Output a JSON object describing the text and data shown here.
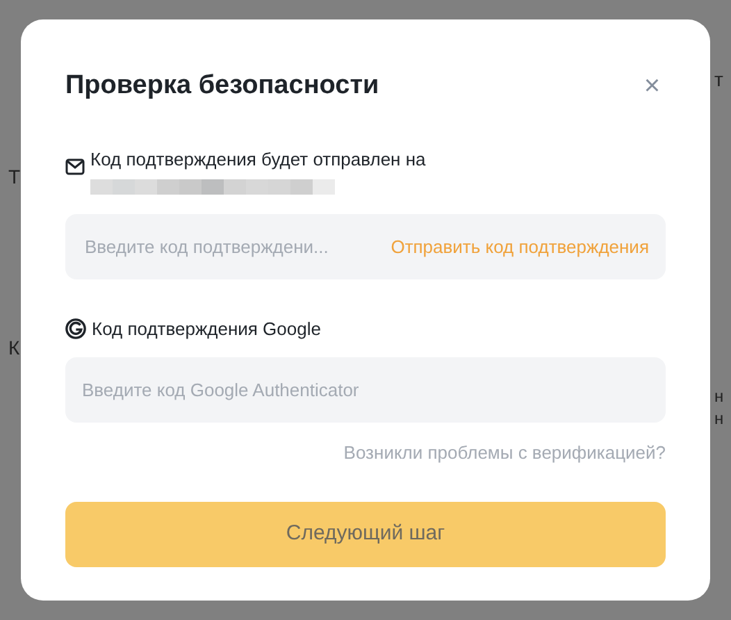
{
  "background": {
    "texts_left": [
      "Т",
      "К"
    ],
    "texts_right": [
      "т",
      "н",
      "н"
    ]
  },
  "dialog": {
    "title": "Проверка безопасности",
    "close": "×",
    "email": {
      "label": "Код подтверждения будет отправлен на",
      "field": {
        "placeholder": "Введите код подтверждени...",
        "action": "Отправить код подтверждения"
      }
    },
    "google": {
      "label": "Код подтверждения Google",
      "field": {
        "placeholder": "Введите код Google Authenticator"
      }
    },
    "help_link": "Возникли проблемы с верификацией?",
    "next_button": {
      "label": "Следующий шаг",
      "disabled": true
    }
  }
}
